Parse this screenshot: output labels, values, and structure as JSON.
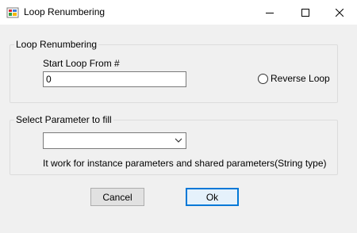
{
  "window": {
    "title": "Loop Renumbering",
    "controls": {
      "minimize": "minimize-icon",
      "maximize": "maximize-icon",
      "close": "close-icon"
    }
  },
  "loop_group": {
    "legend": "Loop Renumbering",
    "start_label": "Start Loop From #",
    "start_value": "0",
    "reverse_label": "Reverse Loop",
    "reverse_checked": false
  },
  "param_group": {
    "legend": "Select Parameter to fill",
    "selected_value": "",
    "note": "It work for instance parameters and shared parameters(String type)"
  },
  "buttons": {
    "cancel": "Cancel",
    "ok": "Ok"
  }
}
